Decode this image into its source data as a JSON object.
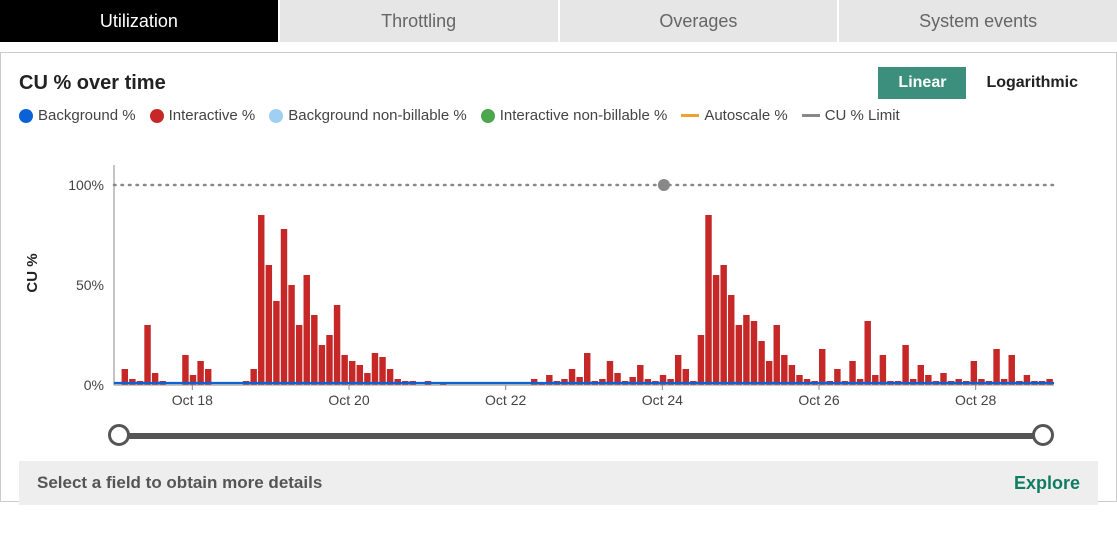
{
  "tabs": [
    {
      "label": "Utilization",
      "active": true
    },
    {
      "label": "Throttling",
      "active": false
    },
    {
      "label": "Overages",
      "active": false
    },
    {
      "label": "System events",
      "active": false
    }
  ],
  "chart_title": "CU % over time",
  "scale": {
    "linear": "Linear",
    "log": "Logarithmic",
    "active": "linear"
  },
  "legend": [
    {
      "label": "Background %",
      "color": "#0b62d6",
      "kind": "dot"
    },
    {
      "label": "Interactive %",
      "color": "#c62828",
      "kind": "dot"
    },
    {
      "label": "Background non-billable %",
      "color": "#9fcff2",
      "kind": "dot"
    },
    {
      "label": "Interactive non-billable %",
      "color": "#4ca64c",
      "kind": "dot"
    },
    {
      "label": "Autoscale %",
      "color": "#f0a030",
      "kind": "line"
    },
    {
      "label": "CU % Limit",
      "color": "#888",
      "kind": "line"
    }
  ],
  "ylabel": "CU %",
  "footer_text": "Select a field to obtain more details",
  "explore_label": "Explore",
  "chart_data": {
    "type": "bar",
    "xlabel": "",
    "ylabel": "CU %",
    "ylim": [
      0,
      110
    ],
    "yticks": [
      0,
      50,
      100
    ],
    "ytick_labels": [
      "0%",
      "50%",
      "100%"
    ],
    "x_categories": [
      "Oct 18",
      "Oct 20",
      "Oct 22",
      "Oct 24",
      "Oct 26",
      "Oct 28"
    ],
    "cu_limit": 100,
    "marker_x_index": 3,
    "series": [
      {
        "name": "Interactive %",
        "color": "#c62828",
        "values": [
          0,
          8,
          3,
          2,
          30,
          6,
          2,
          0,
          0,
          15,
          5,
          12,
          8,
          0,
          0,
          0,
          0,
          2,
          8,
          85,
          60,
          42,
          78,
          50,
          30,
          55,
          35,
          20,
          25,
          40,
          15,
          12,
          10,
          6,
          16,
          14,
          8,
          3,
          2,
          2,
          0,
          2,
          0,
          1,
          0,
          0,
          0,
          0,
          0,
          0,
          0,
          0,
          0,
          0,
          0,
          3,
          1,
          5,
          2,
          3,
          8,
          4,
          16,
          2,
          3,
          12,
          6,
          2,
          4,
          10,
          3,
          2,
          5,
          3,
          15,
          8,
          2,
          25,
          85,
          55,
          60,
          45,
          30,
          35,
          32,
          22,
          12,
          30,
          15,
          10,
          5,
          3,
          2,
          18,
          2,
          8,
          2,
          12,
          3,
          32,
          5,
          15,
          2,
          2,
          20,
          3,
          10,
          5,
          2,
          6,
          2,
          3,
          2,
          12,
          3,
          2,
          18,
          3,
          15,
          2,
          5,
          2,
          2,
          3
        ]
      },
      {
        "name": "Background %",
        "color": "#0b62d6",
        "values_constant": 1
      }
    ]
  }
}
